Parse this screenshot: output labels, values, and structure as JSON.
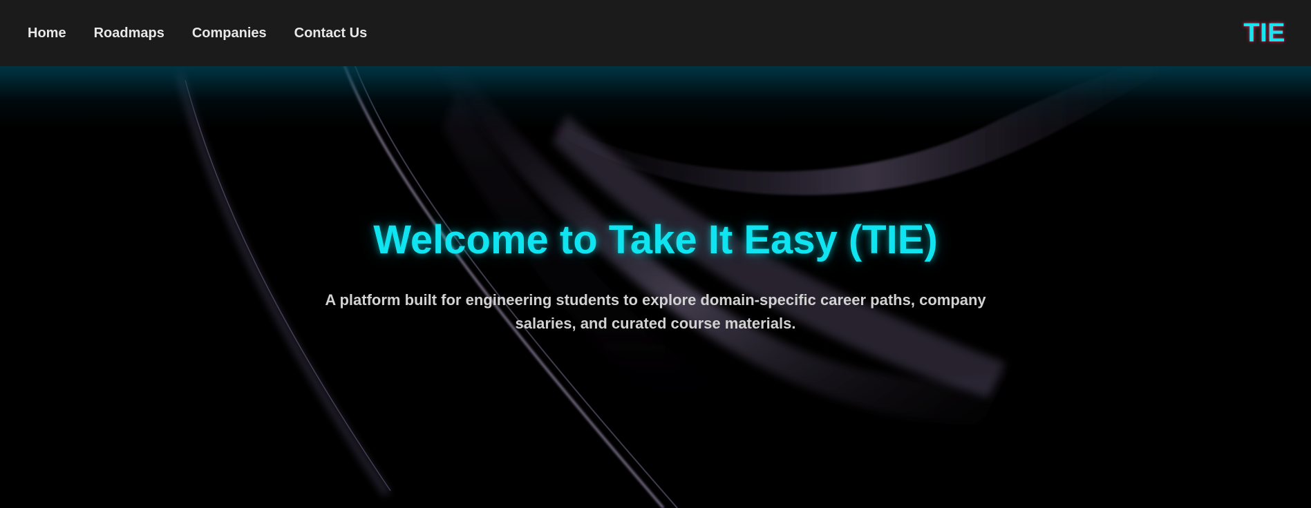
{
  "navbar": {
    "links": [
      {
        "label": "Home"
      },
      {
        "label": "Roadmaps"
      },
      {
        "label": "Companies"
      },
      {
        "label": "Contact Us"
      }
    ],
    "logo": "TIE"
  },
  "hero": {
    "title": "Welcome to Take It Easy (TIE)",
    "subtitle": "A platform built for engineering students to explore domain-specific career paths, company salaries, and curated course materials."
  },
  "colors": {
    "accent": "#10e4f0",
    "navbar_bg": "#1b1b1b",
    "hero_bg": "#000000",
    "logo_glow": "#ff285a"
  }
}
